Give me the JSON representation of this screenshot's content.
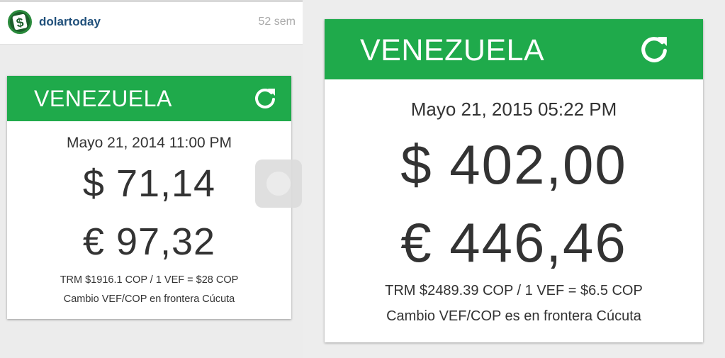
{
  "post": {
    "username": "dolartoday",
    "time_ago": "52 sem",
    "avatar_icon": "dollar-logo-icon"
  },
  "cards": [
    {
      "title": "VENEZUELA",
      "date": "Mayo 21, 2014 11:00 PM",
      "usd": "$ 71,14",
      "eur": "€ 97,32",
      "trm": "TRM $1916.1 COP / 1 VEF = $28 COP",
      "note": "Cambio VEF/COP en frontera Cúcuta",
      "refresh_icon": "refresh-icon"
    },
    {
      "title": "VENEZUELA",
      "date": "Mayo 21, 2015 05:22 PM",
      "usd": "$ 402,00",
      "eur": "€ 446,46",
      "trm": "TRM $2489.39 COP / 1 VEF = $6.5 COP",
      "note": "Cambio VEF/COP es en frontera Cúcuta",
      "refresh_icon": "refresh-icon"
    }
  ],
  "colors": {
    "header_green": "#1faa4b",
    "username_blue": "#1f4f7a",
    "text_dark": "#333333"
  }
}
